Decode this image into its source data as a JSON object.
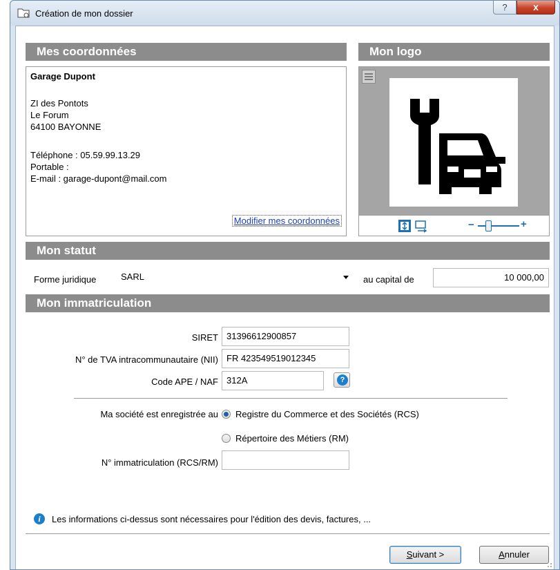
{
  "window": {
    "title": "Création de mon dossier",
    "help_label": "?",
    "close_label": "x"
  },
  "coordonnees": {
    "header": "Mes coordonnées",
    "company": "Garage Dupont",
    "address_1": "ZI des Pontots",
    "address_2": "Le Forum",
    "address_3": "64100 BAYONNE",
    "telephone": "Téléphone : 05.59.99.13.29",
    "portable": "Portable :",
    "email": "E-mail : garage-dupont@mail.com",
    "modify_link": "Modifier mes coordonnées"
  },
  "logo": {
    "header": "Mon logo",
    "icon": "wrench-car-icon",
    "zoom_minus": "−",
    "zoom_plus": "+"
  },
  "statut": {
    "header": "Mon statut",
    "forme_label": "Forme juridique",
    "forme_value": "SARL",
    "capital_label": "au capital de",
    "capital_value": "10 000,00"
  },
  "immatriculation": {
    "header": "Mon immatriculation",
    "siret_label": "SIRET",
    "siret_value": "31396612900857",
    "tva_label": "N° de TVA intracommunautaire (NII)",
    "tva_value": "FR 423549519012345",
    "ape_label": "Code APE / NAF",
    "ape_value": "312A",
    "ape_help": "?",
    "registre_label": "Ma société est enregistrée au",
    "option_rcs": "Registre du Commerce et des Sociétés (RCS)",
    "option_rm": "Répertoire des Métiers (RM)",
    "selected_option": "RCS",
    "numero_label": "N° immatriculation (RCS/RM)",
    "numero_value": ""
  },
  "footer": {
    "info_icon": "i",
    "info_text": "Les informations ci-dessus sont nécessaires pour l'édition des devis, factures, ...",
    "next_mnemonic": "S",
    "next_rest": "uivant >",
    "cancel_mnemonic": "A",
    "cancel_rest": "nnuler"
  },
  "colors": {
    "section_header_bg": "#8c8c8c",
    "link": "#1f40b8",
    "info_blue": "#1d7ec9",
    "close_red": "#c7432b"
  }
}
